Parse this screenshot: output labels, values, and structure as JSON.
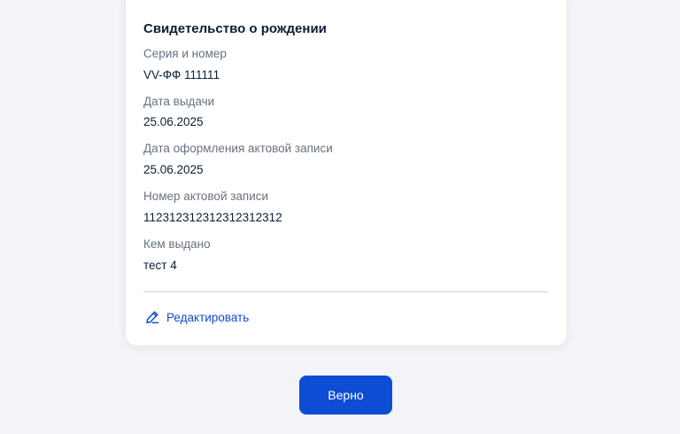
{
  "card": {
    "title": "Свидетельство о рождении",
    "fields": [
      {
        "label": "Серия и номер",
        "value": "VV-ФФ 111111"
      },
      {
        "label": "Дата выдачи",
        "value": "25.06.2025"
      },
      {
        "label": "Дата оформления актовой записи",
        "value": "25.06.2025"
      },
      {
        "label": "Номер актовой записи",
        "value": "112312312312312312312"
      },
      {
        "label": "Кем выдано",
        "value": "тест 4"
      }
    ],
    "edit_label": "Редактировать",
    "edit_icon": "pencil-icon"
  },
  "actions": {
    "confirm_label": "Верно"
  },
  "colors": {
    "accent": "#0d4cd3",
    "text": "#0b1f33",
    "muted": "#66727f",
    "background": "#f2f4f8"
  }
}
